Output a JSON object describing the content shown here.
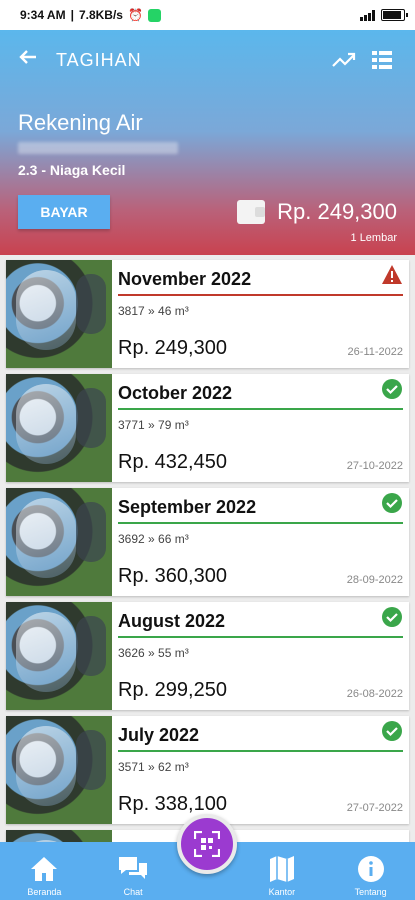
{
  "status_bar": {
    "time": "9:34 AM",
    "network": "7.8KB/s"
  },
  "header": {
    "title": "TAGIHAN"
  },
  "account": {
    "name": "Rekening Air",
    "category": "2.3 - Niaga Kecil",
    "pay_label": "BAYAR",
    "total": "Rp. 249,300",
    "sheets": "1 Lembar"
  },
  "bills": [
    {
      "month": "November 2022",
      "usage": "3817 » 46 m³",
      "amount": "Rp. 249,300",
      "date": "26-11-2022",
      "status": "warning"
    },
    {
      "month": "October 2022",
      "usage": "3771 » 79 m³",
      "amount": "Rp. 432,450",
      "date": "27-10-2022",
      "status": "paid"
    },
    {
      "month": "September 2022",
      "usage": "3692 » 66 m³",
      "amount": "Rp. 360,300",
      "date": "28-09-2022",
      "status": "paid"
    },
    {
      "month": "August 2022",
      "usage": "3626 » 55 m³",
      "amount": "Rp. 299,250",
      "date": "26-08-2022",
      "status": "paid"
    },
    {
      "month": "July 2022",
      "usage": "3571 » 62 m³",
      "amount": "Rp. 338,100",
      "date": "27-07-2022",
      "status": "paid"
    }
  ],
  "nav": {
    "home": "Beranda",
    "chat": "Chat",
    "office": "Kantor",
    "about": "Tentang"
  },
  "colors": {
    "accent": "#5aaef0",
    "paid": "#3aa64a",
    "warning": "#c0392b",
    "fab": "#9b3ad0"
  }
}
